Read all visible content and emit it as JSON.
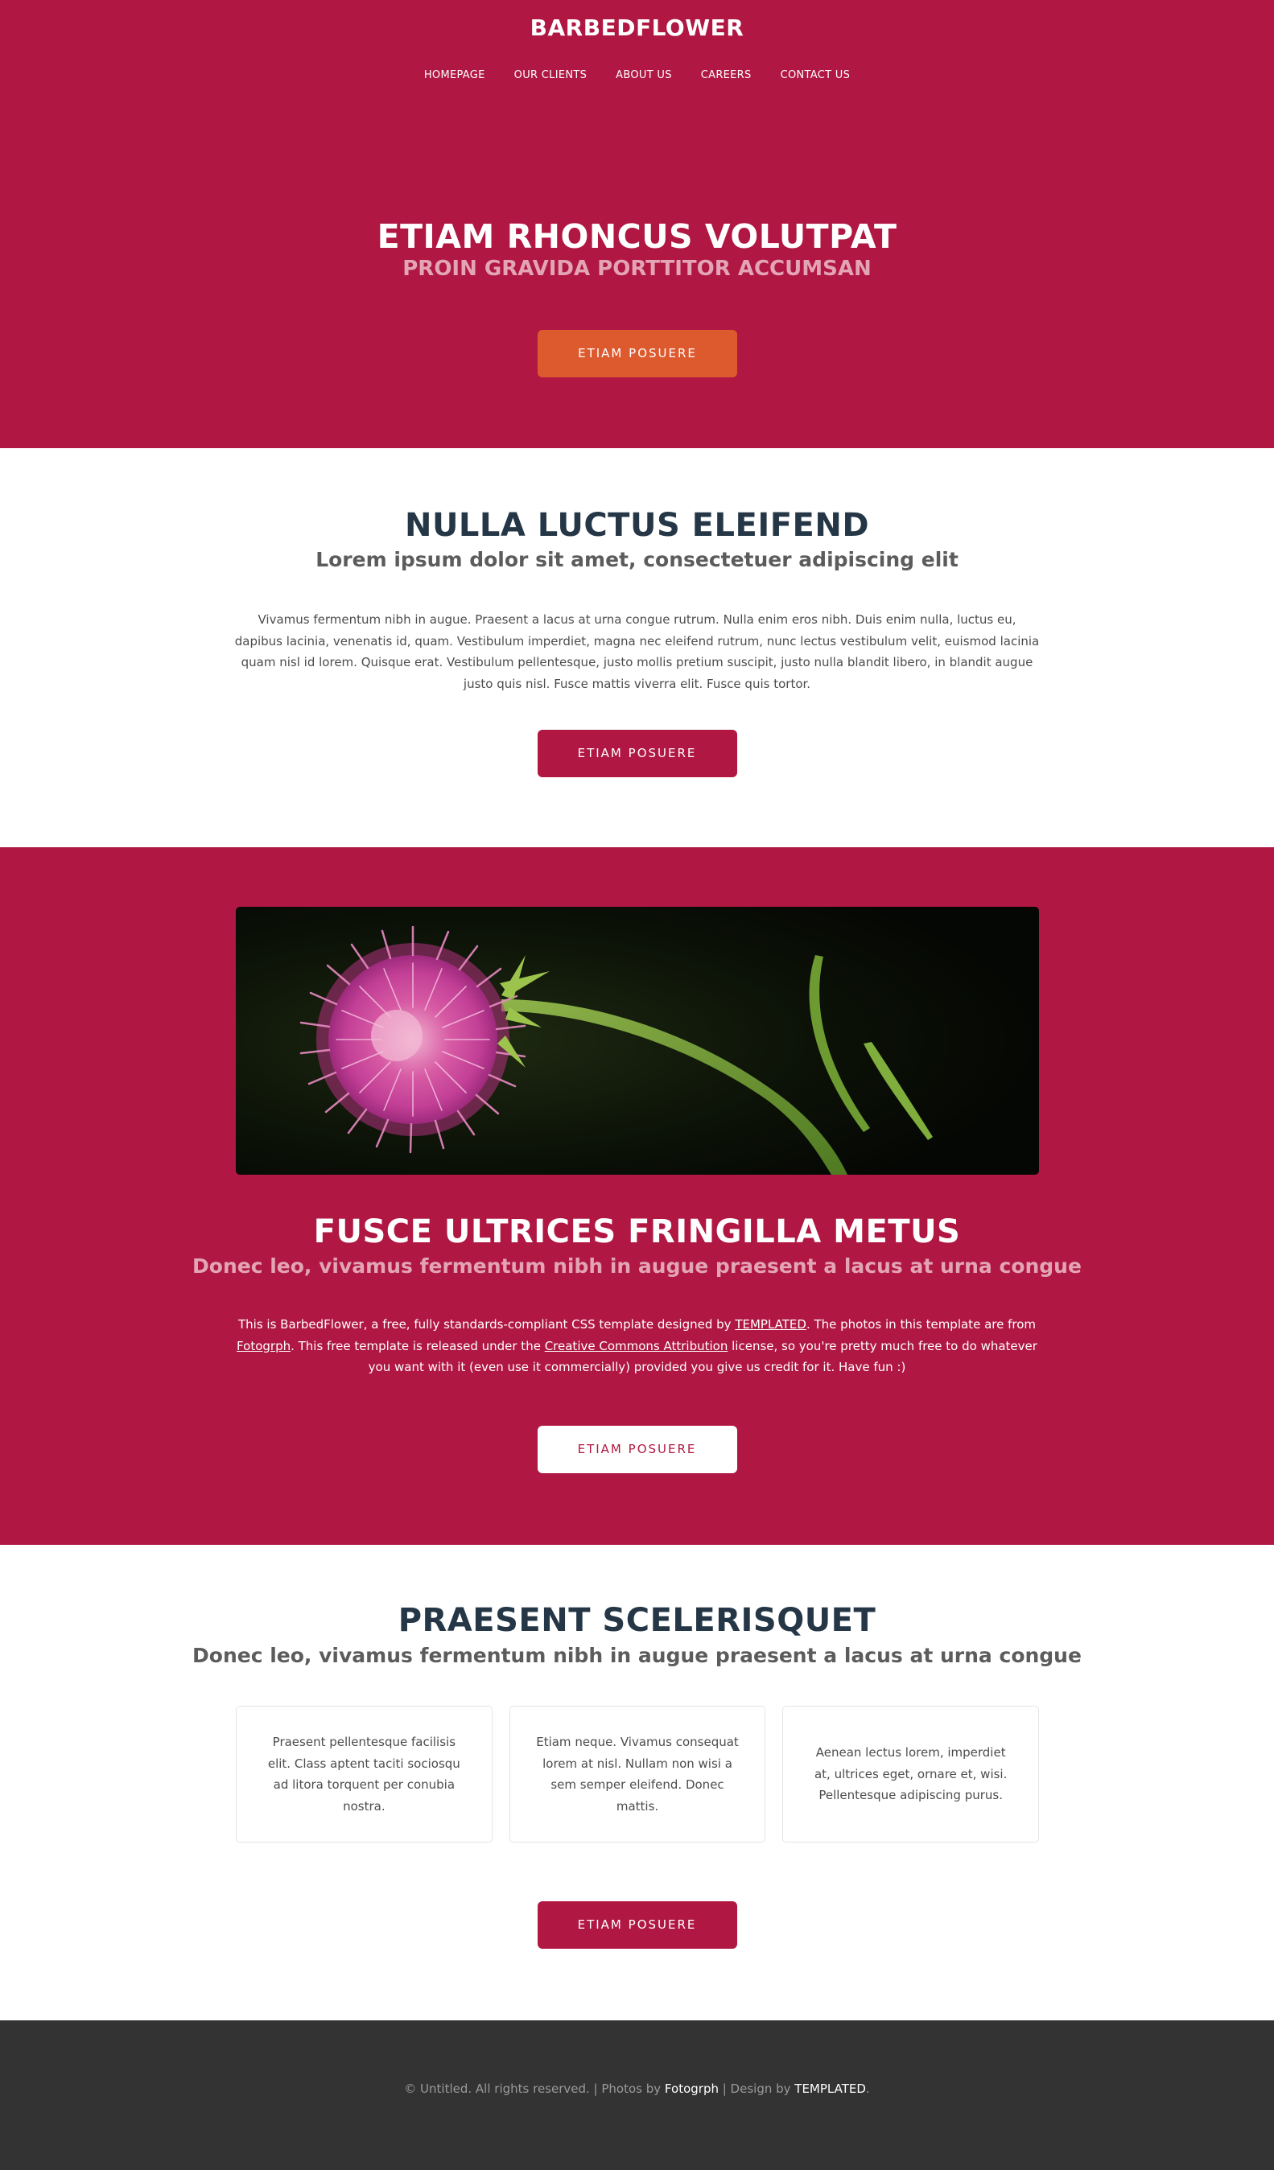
{
  "header": {
    "brand": "BARBEDFLOWER",
    "nav": [
      "HOMEPAGE",
      "OUR CLIENTS",
      "ABOUT US",
      "CAREERS",
      "CONTACT US"
    ]
  },
  "banner": {
    "title": "ETIAM RHONCUS VOLUTPAT",
    "subtitle": "PROIN GRAVIDA PORTTITOR ACCUMSAN",
    "button": "ETIAM POSUERE"
  },
  "section_one": {
    "title": "NULLA LUCTUS ELEIFEND",
    "subtitle": "Lorem ipsum dolor sit amet, consectetuer adipiscing elit",
    "body": "Vivamus fermentum nibh in augue. Praesent a lacus at urna congue rutrum. Nulla enim eros nibh. Duis enim nulla, luctus eu, dapibus lacinia, venenatis id, quam. Vestibulum imperdiet, magna nec eleifend rutrum, nunc lectus vestibulum velit, euismod lacinia quam nisl id lorem. Quisque erat. Vestibulum pellentesque, justo mollis pretium suscipit, justo nulla blandit libero, in blandit augue justo quis nisl. Fusce mattis viverra elit. Fusce quis tortor.",
    "button": "ETIAM POSUERE"
  },
  "section_two": {
    "title": "FUSCE ULTRICES FRINGILLA METUS",
    "subtitle": "Donec leo, vivamus fermentum nibh in augue praesent a lacus at urna congue",
    "text_1": "This is BarbedFlower, a free, fully standards-compliant CSS template designed by ",
    "link_1": "TEMPLATED",
    "text_2": ". The photos in this template are from ",
    "link_2": "Fotogrph",
    "text_3": ". This free template is released under the ",
    "link_3": "Creative Commons Attribution",
    "text_4": " license, so you're pretty much free to do whatever you want with it (even use it commercially) provided you give us credit for it. Have fun :)",
    "button": "ETIAM POSUERE"
  },
  "section_three": {
    "title": "PRAESENT SCELERISQUET",
    "subtitle": "Donec leo, vivamus fermentum nibh in augue praesent a lacus at urna congue",
    "boxes": [
      "Praesent pellentesque facilisis elit. Class aptent taciti sociosqu ad litora torquent per conubia nostra.",
      "Etiam neque. Vivamus consequat lorem at nisl. Nullam non wisi a sem semper eleifend. Donec mattis.",
      "Aenean lectus lorem, imperdiet at, ultrices eget, ornare et, wisi. Pellentesque adipiscing purus."
    ],
    "button": "ETIAM POSUERE"
  },
  "footer": {
    "text_1": "© Untitled. All rights reserved. | Photos by ",
    "link_1": "Fotogrph",
    "text_2": " | Design by ",
    "link_2": "TEMPLATED",
    "text_3": "."
  },
  "colors": {
    "primary": "#b01742",
    "accent": "#dd5a2f",
    "heading": "#253746",
    "footer_bg": "#333333"
  }
}
